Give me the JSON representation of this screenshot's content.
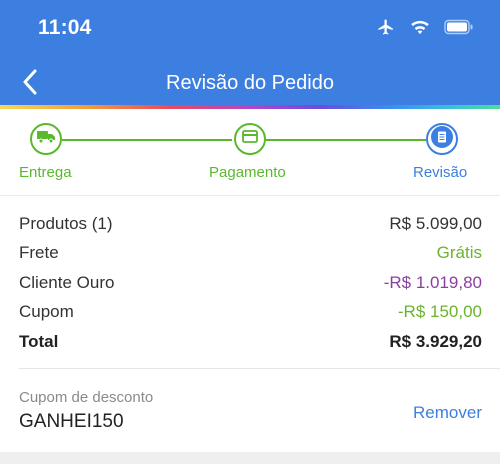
{
  "status_bar": {
    "time": "11:04",
    "icons": [
      "airplane-icon",
      "wifi-icon",
      "battery-icon"
    ]
  },
  "nav": {
    "title": "Revisão do Pedido",
    "back_icon": "chevron-left-icon"
  },
  "stepper": {
    "steps": [
      {
        "label": "Entrega",
        "icon": "truck-icon",
        "state": "done"
      },
      {
        "label": "Pagamento",
        "icon": "credit-card-icon",
        "state": "done"
      },
      {
        "label": "Revisão",
        "icon": "document-icon",
        "state": "current"
      }
    ]
  },
  "summary": {
    "rows": [
      {
        "label": "Produtos (1)",
        "value": "R$ 5.099,00"
      },
      {
        "label": "Frete",
        "value": "Grátis"
      },
      {
        "label": "Cliente Ouro",
        "value": "-R$ 1.019,80"
      },
      {
        "label": "Cupom",
        "value": "-R$ 150,00"
      },
      {
        "label": "Total",
        "value": "R$ 3.929,20"
      }
    ]
  },
  "coupon": {
    "label": "Cupom de desconto",
    "code": "GANHEI150",
    "remove_label": "Remover"
  },
  "colors": {
    "primary": "#3d7fe0",
    "success": "#5ab82c",
    "discount_purple": "#8a3f9e"
  }
}
